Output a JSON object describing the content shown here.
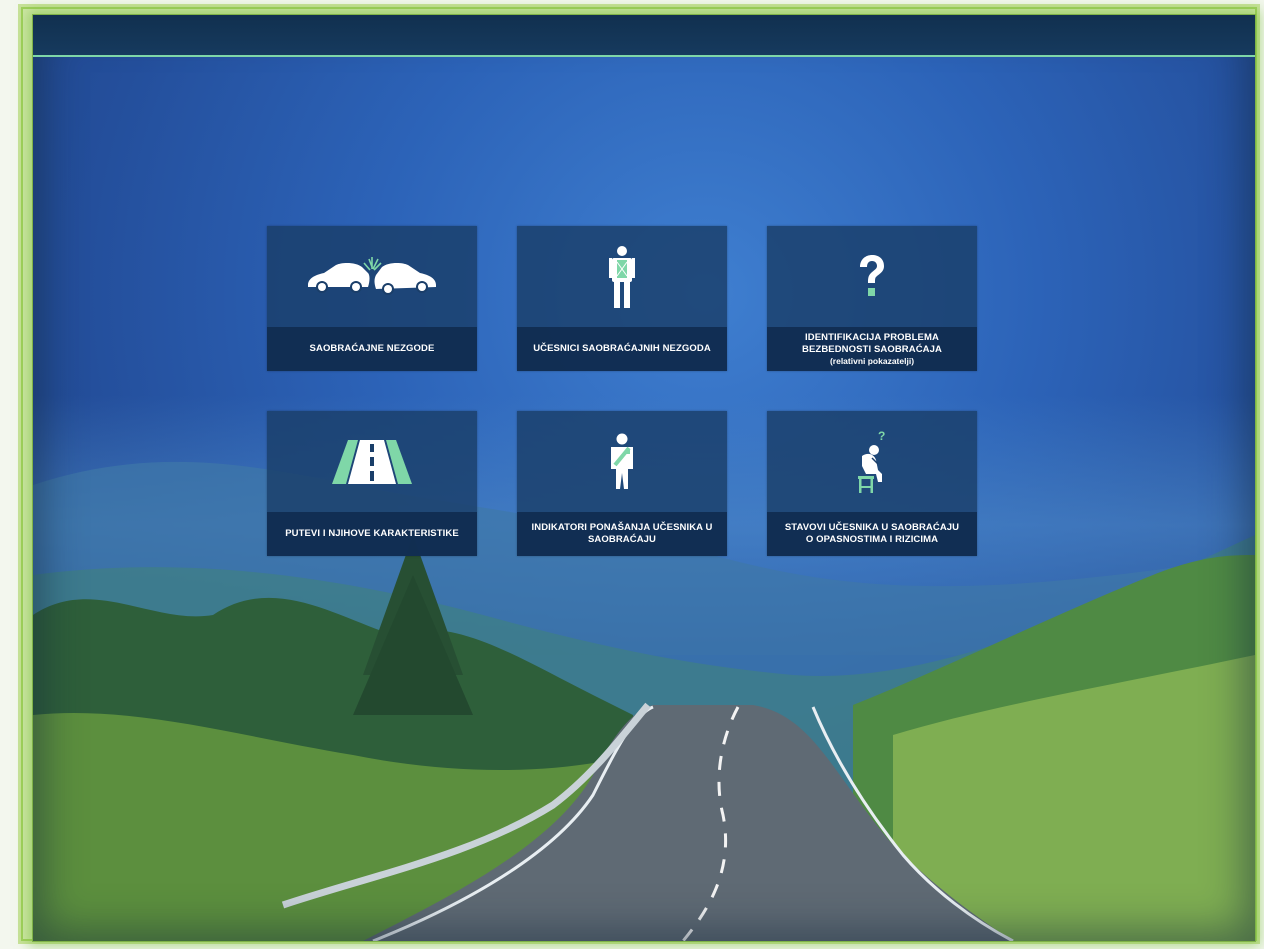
{
  "tiles": [
    {
      "label": "SAOBRAĆAJNE NEZGODE",
      "icon": "car-crash-icon"
    },
    {
      "label": "UČESNICI SAOBRAĆAJNIH NEZGODA",
      "icon": "pedestrian-icon"
    },
    {
      "label": "IDENTIFIKACIJA PROBLEMA\nBEZBEDNOSTI SAOBRAĆAJA",
      "sublabel": "(relativni pokazatelji)",
      "icon": "question-mark-icon"
    },
    {
      "label": "PUTEVI I NJIHOVE KARAKTERISTIKE",
      "icon": "road-icon"
    },
    {
      "label": "INDIKATORI PONAŠANJA UČESNIKA U\nSAOBRAĆAJU",
      "icon": "seatbelt-person-icon"
    },
    {
      "label": "STAVOVI UČESNIKA U SAOBRAĆAJU\nO OPASNOSTIMA I RIZICIMA",
      "icon": "thinking-person-icon"
    }
  ],
  "colors": {
    "accent": "#7fd7a8",
    "tile_bg": "#1a3e69",
    "frame_green": "#9fcf5c"
  }
}
